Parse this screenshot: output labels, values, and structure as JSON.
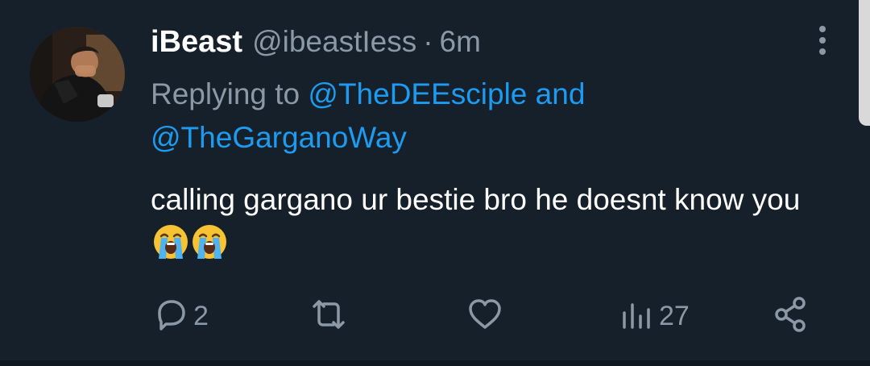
{
  "tweet": {
    "display_name": "iBeast",
    "handle": "@ibeastIess",
    "separator": "·",
    "time": "6m",
    "replying_prefix": "Replying to ",
    "mentions": [
      "@TheDEEsciple",
      "@TheGarganoWay"
    ],
    "mention_joiner": " and",
    "text": "calling gargano ur bestie bro he doesnt know you",
    "emojis": [
      "loudly-crying-face",
      "loudly-crying-face"
    ]
  },
  "actions": {
    "reply_count": "2",
    "retweet_count": "",
    "like_count": "",
    "views_count": "27"
  },
  "icons": [
    "avatar",
    "more-icon",
    "reply-icon",
    "retweet-icon",
    "like-icon",
    "views-icon",
    "share-icon"
  ],
  "colors": {
    "background": "#15202b",
    "text_primary": "#ffffff",
    "text_secondary": "#8b98a5",
    "link": "#1d9bf0"
  }
}
